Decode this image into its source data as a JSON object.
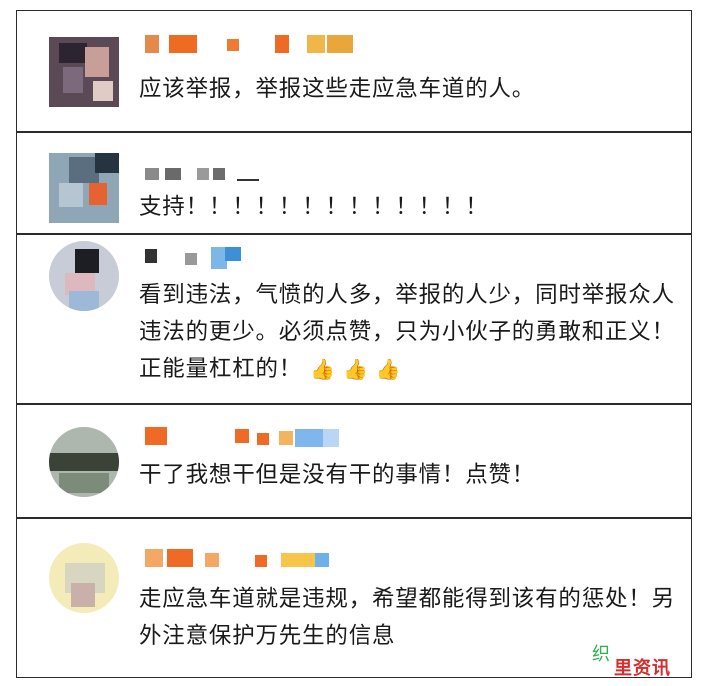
{
  "comments": [
    {
      "text": "应该举报，举报这些走应急车道的人。"
    },
    {
      "text": "支持！！！！！！！！！！！！！"
    },
    {
      "text": "看到违法，气愤的人多，举报的人少，同时举报众人违法的更少。必须点赞，只为小伙子的勇敢和正义！正能量杠杠的！",
      "thumbs": "👍 👍 👍"
    },
    {
      "text": "干了我想干但是没有干的事情！点赞！"
    },
    {
      "text": "走应急车道就是违规，希望都能得到该有的惩处！另外注意保护万先生的信息"
    }
  ],
  "watermark": {
    "part1": "织",
    "part2": "里资讯"
  },
  "colors": {
    "border": "#2b2b2b",
    "text": "#1a1a1a",
    "thumb": "#e6a63a",
    "wm_green": "#2fb24a",
    "wm_red": "#d62d2d"
  }
}
